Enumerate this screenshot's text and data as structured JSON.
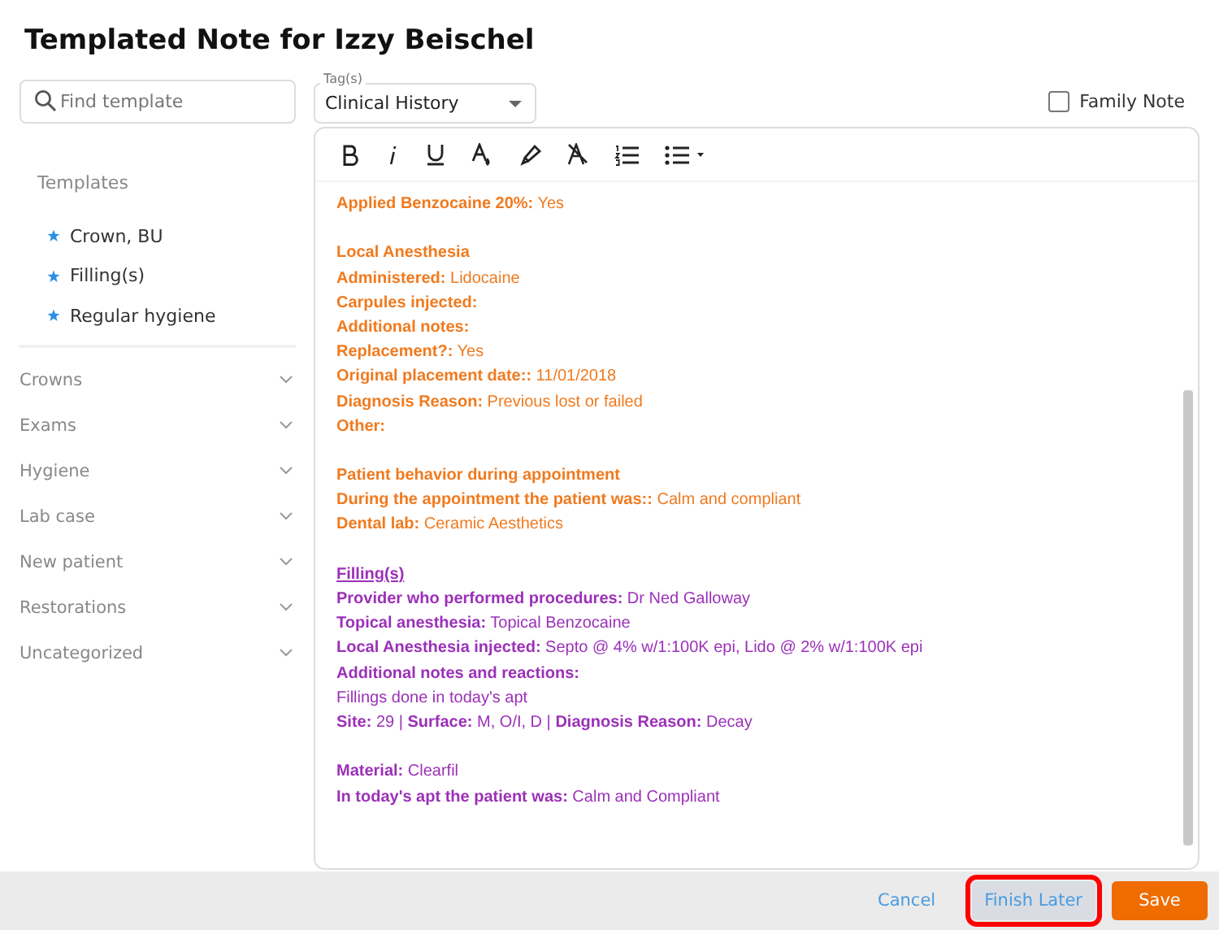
{
  "title": "Templated Note for Izzy Beischel",
  "search": {
    "placeholder": "Find template"
  },
  "templates_label": "Templates",
  "favorites": [
    "Crown, BU",
    "Filling(s)",
    "Regular hygiene"
  ],
  "categories": [
    {
      "label": "Crowns",
      "expanded": false
    },
    {
      "label": "Exams",
      "expanded": false
    },
    {
      "label": "Hygiene",
      "expanded": false
    },
    {
      "label": "Lab case",
      "expanded": false
    },
    {
      "label": "New patient",
      "expanded": false
    },
    {
      "label": "Restorations",
      "expanded": false
    },
    {
      "label": "Uncategorized",
      "expanded": false
    }
  ],
  "tags": {
    "label": "Tag(s)",
    "value": "Clinical History"
  },
  "family_note": {
    "label": "Family Note",
    "checked": false
  },
  "note_lines": [
    {
      "kind": "field",
      "text": "**Applied Benzocaine 20%:** Yes",
      "color": "#f07a1e"
    },
    {
      "kind": "heading",
      "text": "Local Anesthesia",
      "color": "#f07a1e",
      "space_before": true
    },
    {
      "kind": "field",
      "text": "**Administered:** Lidocaine",
      "color": "#f07a1e"
    },
    {
      "kind": "field",
      "text": "**Carpules injected:**",
      "color": "#f07a1e"
    },
    {
      "kind": "field",
      "text": "**Additional notes:**",
      "color": "#f07a1e"
    },
    {
      "kind": "field",
      "text": "**Replacement?:** Yes",
      "color": "#f07a1e"
    },
    {
      "kind": "field",
      "text": "**Original placement date::** 11/01/2018",
      "color": "#f07a1e"
    },
    {
      "kind": "field",
      "text": "**Diagnosis Reason:** Previous lost or failed",
      "color": "#f07a1e"
    },
    {
      "kind": "field",
      "text": "**Other:**",
      "color": "#f07a1e"
    },
    {
      "kind": "heading",
      "text": "Patient behavior during appointment",
      "color": "#f07a1e",
      "space_before": true
    },
    {
      "kind": "field",
      "text": "**During the appointment the patient was::** Calm and compliant",
      "color": "#f07a1e"
    },
    {
      "kind": "field",
      "text": "**Dental lab:** Ceramic Aesthetics",
      "color": "#f07a1e"
    },
    {
      "kind": "section",
      "text": "Filling(s)",
      "color": "#9b30b8",
      "space_before": true
    },
    {
      "kind": "field",
      "text": "**Provider who performed procedures:** Dr Ned Galloway",
      "color": "#9b30b8"
    },
    {
      "kind": "field",
      "text": "**Topical anesthesia:** Topical Benzocaine",
      "color": "#9b30b8"
    },
    {
      "kind": "field",
      "text": "**Local Anesthesia injected:** Septo @ 4% w/1:100K epi, Lido @ 2% w/1:100K epi",
      "color": "#9b30b8"
    },
    {
      "kind": "field",
      "text": "**Additional notes and reactions:**",
      "color": "#9b30b8"
    },
    {
      "kind": "field",
      "text": "Fillings done in today's apt",
      "color": "#9b30b8"
    },
    {
      "kind": "field",
      "text": "**Site:** 29 | **Surface:** M, O/I, D | **Diagnosis Reason:** Decay",
      "color": "#9b30b8"
    },
    {
      "kind": "field",
      "text": "**Material:** Clearfil",
      "color": "#9b30b8",
      "space_before": true
    },
    {
      "kind": "field",
      "text": "**In today's apt the patient was:** Calm and Compliant",
      "color": "#9b30b8"
    }
  ],
  "buttons": [
    {
      "kind": "link",
      "label": "Cancel",
      "highlighted": false
    },
    {
      "kind": "secondary",
      "label": "Finish Later",
      "highlighted": true
    },
    {
      "kind": "primary",
      "label": "Save",
      "highlighted": false
    }
  ]
}
